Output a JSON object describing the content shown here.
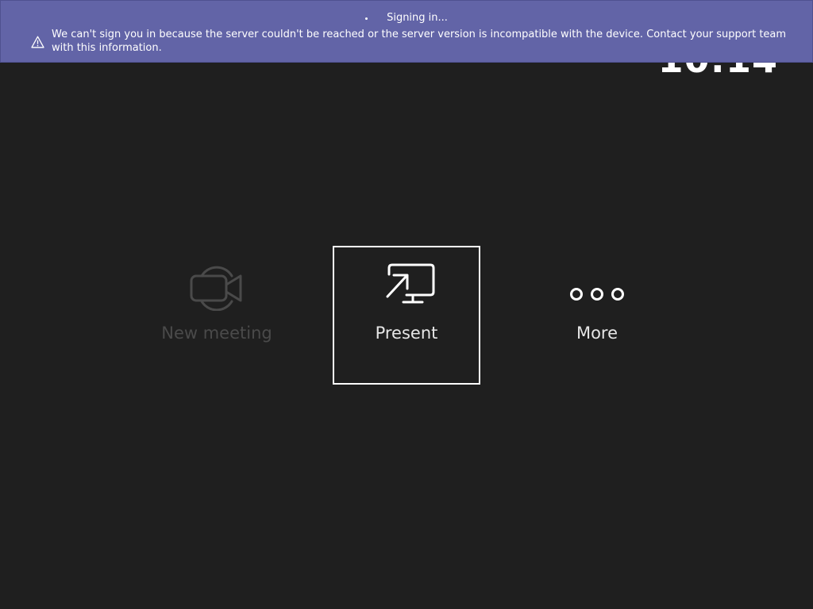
{
  "clock": {
    "time": "10:14"
  },
  "banner": {
    "status_text": "Signing in...",
    "message": "We can't sign you in because the server couldn't be reached or the server version is incompatible with the device. Contact your support team with this information.",
    "icon": "warning-icon",
    "background_color": "#6264a7"
  },
  "tiles": [
    {
      "label": "New meeting",
      "icon": "video-camera-icon",
      "state": "disabled"
    },
    {
      "label": "Present",
      "icon": "share-screen-icon",
      "state": "focused"
    },
    {
      "label": "More",
      "icon": "more-options-icon",
      "state": "enabled"
    }
  ],
  "colors": {
    "background": "#1f1f1f",
    "disabled_text": "#4a4a4a",
    "enabled_text": "#e6e6e6",
    "focus_border": "#ffffff"
  }
}
